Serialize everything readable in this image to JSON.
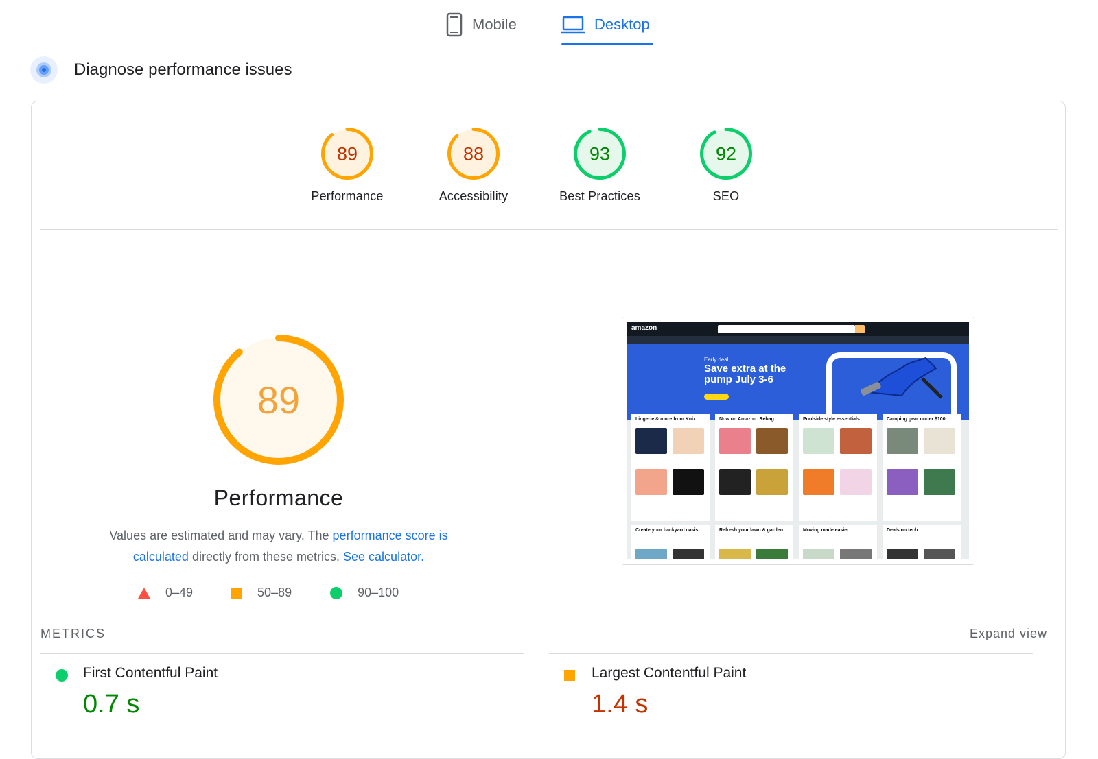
{
  "tabs": {
    "mobile": {
      "label": "Mobile"
    },
    "desktop": {
      "label": "Desktop",
      "active": true
    }
  },
  "diagnose": {
    "title": "Diagnose performance issues"
  },
  "scores": [
    {
      "label": "Performance",
      "value": "89",
      "fraction": 0.89,
      "status": "average",
      "color": "#ffa400",
      "text_color": "#c33300",
      "bg": "#fff3e0"
    },
    {
      "label": "Accessibility",
      "value": "88",
      "fraction": 0.88,
      "status": "average",
      "color": "#ffa400",
      "text_color": "#c33300",
      "bg": "#fff3e0"
    },
    {
      "label": "Best Practices",
      "value": "93",
      "fraction": 0.93,
      "status": "pass",
      "color": "#0cce6b",
      "text_color": "#008800",
      "bg": "#e6f7ec"
    },
    {
      "label": "SEO",
      "value": "92",
      "fraction": 0.92,
      "status": "pass",
      "color": "#0cce6b",
      "text_color": "#008800",
      "bg": "#e6f7ec"
    }
  ],
  "performance": {
    "title": "Performance",
    "score": "89",
    "fraction": 0.89,
    "color": "#ffa400",
    "description_pre": "Values are estimated and may vary. The ",
    "link1": "performance score is calculated",
    "description_mid": " directly from these metrics. ",
    "link2": "See calculator."
  },
  "legend": [
    {
      "label": "0–49",
      "shape": "triangle",
      "color": "#ff4e42"
    },
    {
      "label": "50–89",
      "shape": "square",
      "color": "#ffa400"
    },
    {
      "label": "90–100",
      "shape": "circle",
      "color": "#0cce6b"
    }
  ],
  "thumbnail": {
    "logo": "amazon",
    "hero_small": "Early deal",
    "hero_big": "Save extra at the pump July 3-6",
    "cards": [
      "Lingerie & more from Knix",
      "Now on Amazon: Rebag",
      "Poolside style essentials",
      "Camping gear under $100",
      "Create your backyard oasis",
      "Refresh your lawn & garden",
      "Moving made easier",
      "Deals on tech"
    ]
  },
  "metrics": {
    "heading": "METRICS",
    "expand": "Expand view",
    "items": [
      {
        "label": "First Contentful Paint",
        "value": "0.7 s",
        "color": "#0cce6b",
        "value_color": "#008800",
        "shape": "circle"
      },
      {
        "label": "Largest Contentful Paint",
        "value": "1.4 s",
        "color": "#ffa400",
        "value_color": "#c33300",
        "shape": "square"
      }
    ]
  }
}
